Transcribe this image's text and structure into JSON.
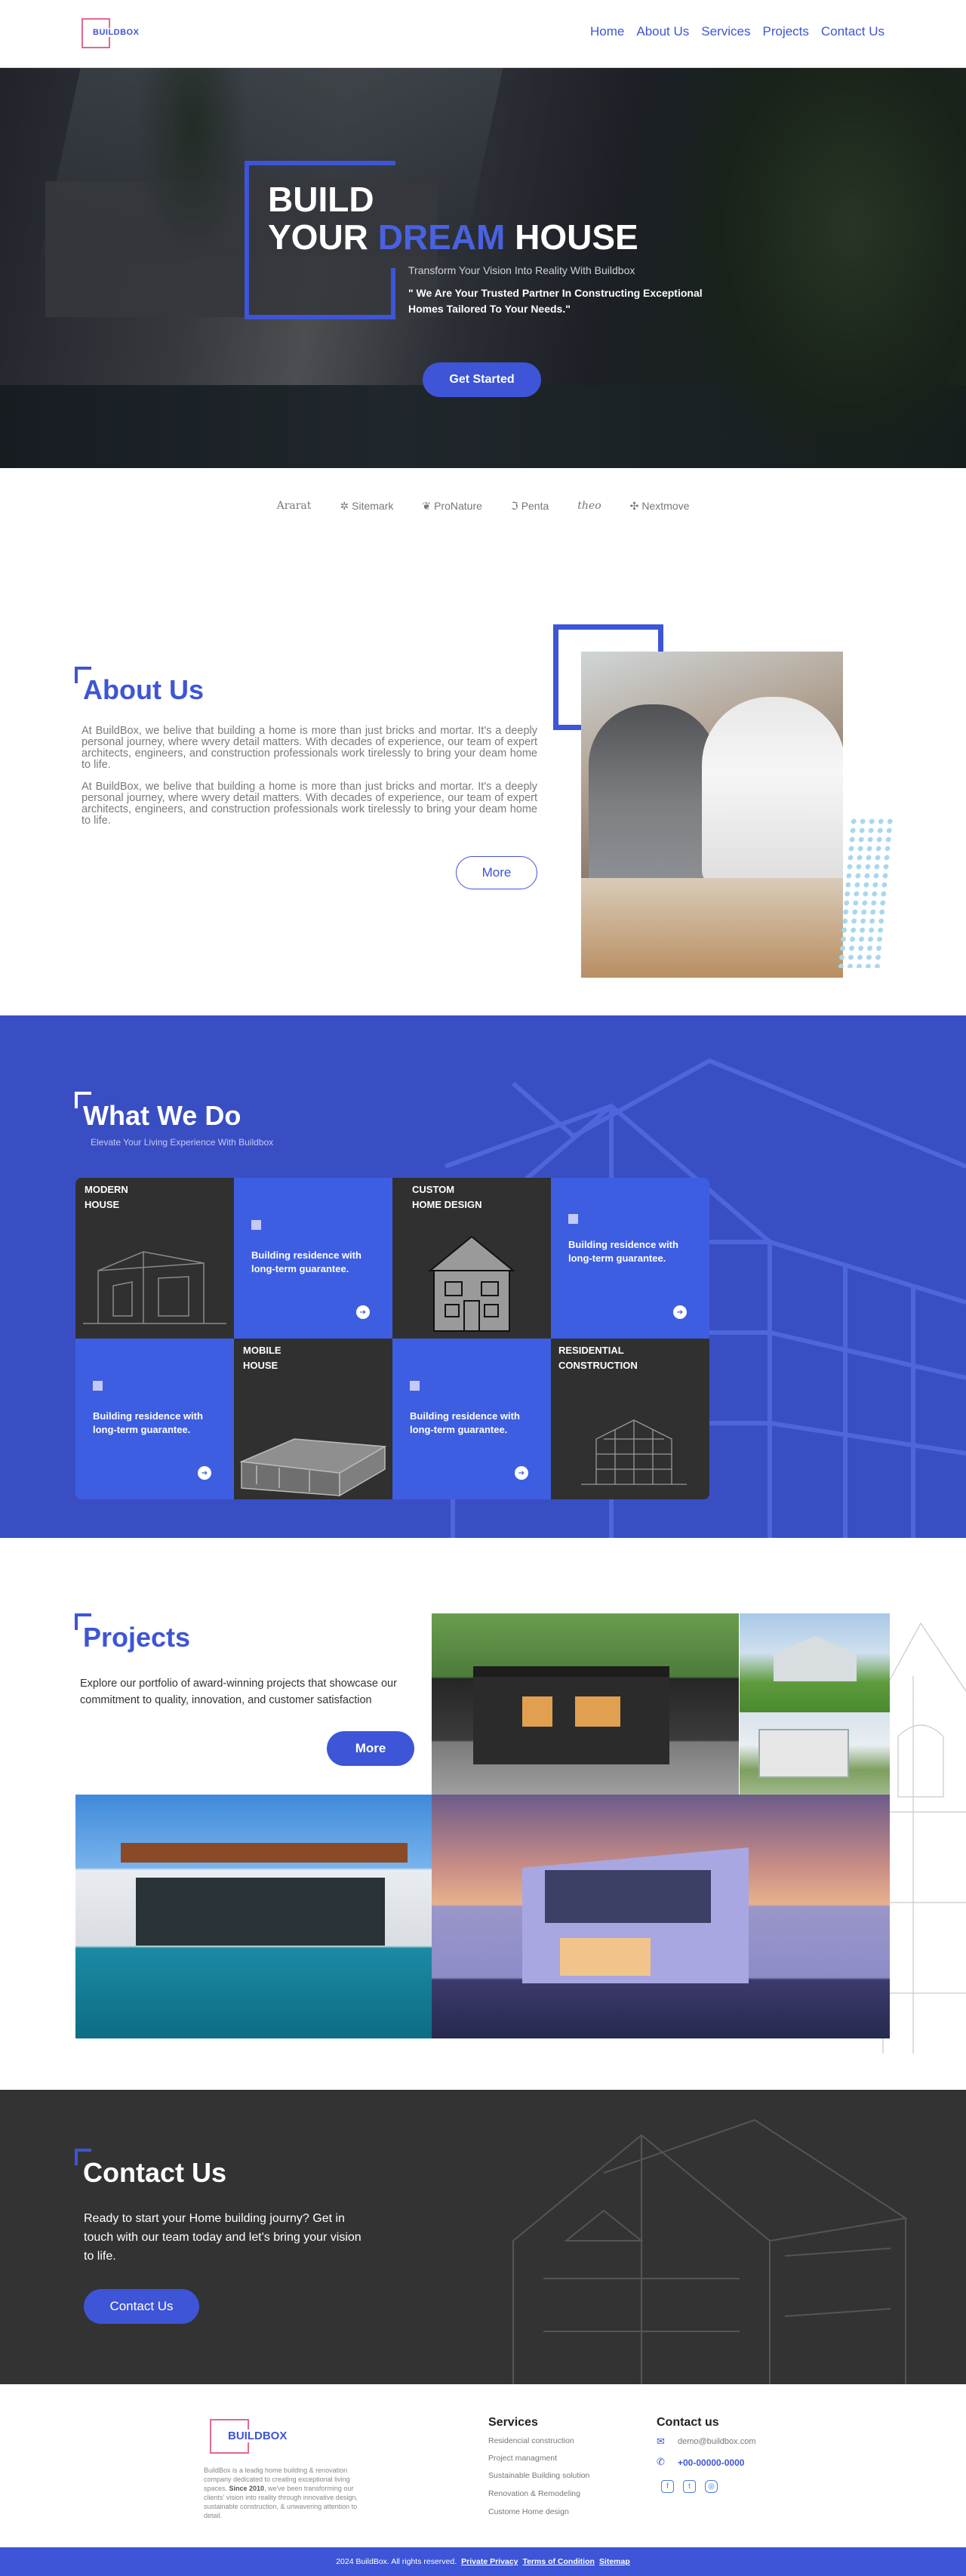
{
  "header": {
    "logo_text": "BUILDBOX",
    "nav": [
      {
        "label": "Home"
      },
      {
        "label": "About Us"
      },
      {
        "label": "Services"
      },
      {
        "label": "Projects"
      },
      {
        "label": "Contact Us"
      }
    ]
  },
  "hero": {
    "title_line1": "BUILD",
    "title_your": "YOUR ",
    "title_dream": "DREAM",
    "title_house": " HOUSE",
    "subtitle": "Transform Your Vision Into Reality With Buildbox",
    "quote": "\" We Are Your Trusted Partner In Constructing Exceptional Homes Tailored To Your Needs.\"",
    "cta_label": "Get Started"
  },
  "partners": [
    {
      "name": "Ararat",
      "icon": ""
    },
    {
      "name": "Sitemark",
      "icon": "asterisk-icon"
    },
    {
      "name": "ProNature",
      "icon": "leaf-icon"
    },
    {
      "name": "Penta",
      "icon": "penta-icon"
    },
    {
      "name": "theo",
      "icon": ""
    },
    {
      "name": "Nextmove",
      "icon": "arrows-icon"
    }
  ],
  "about": {
    "title": "About Us",
    "paragraph1": "At BuildBox, we belive that building a home is more than just bricks and mortar. It's a deeply personal journey, where wvery detail matters. With decades of experience, our team of expert architects, engineers, and construction professionals work tirelessly to bring your deam home to life.",
    "paragraph2": "At BuildBox, we belive that building a home is more than just bricks and mortar. It's a deeply personal journey, where wvery detail matters. With decades of experience, our team of expert architects, engineers, and construction professionals work tirelessly to bring your deam home to life.",
    "more_label": "More"
  },
  "services": {
    "title": "What We Do",
    "subtitle": "Elevate Your Living Experience With Buildbox",
    "cells": [
      {
        "kind": "image",
        "title": "MODERN\nHOUSE"
      },
      {
        "kind": "text",
        "text": "Building residence with long-term guarantee."
      },
      {
        "kind": "image",
        "title": "CUSTOM\nHOME DESIGN"
      },
      {
        "kind": "text",
        "text": "Building residence with long-term guarantee."
      },
      {
        "kind": "text",
        "text": "Building residence with long-term guarantee."
      },
      {
        "kind": "image",
        "title": "MOBILE\nHOUSE"
      },
      {
        "kind": "text",
        "text": "Building residence with long-term guarantee."
      },
      {
        "kind": "image",
        "title": "RESIDENTIAL\nCONSTRUCTION"
      }
    ]
  },
  "projects": {
    "title": "Projects",
    "text": "Explore our portfolio of award-winning projects that showcase our commitment to quality, innovation, and customer satisfaction",
    "more_label": "More"
  },
  "contact": {
    "title": "Contact Us",
    "text": "Ready to start your Home building journy? Get in touch with our team today and let's bring your vision to life.",
    "button_label": "Contact Us"
  },
  "footer": {
    "logo_text": "BUILDBOX",
    "description_a": "BuildBox is a leadig home building & renovation company dedicated to creating exceptional living spaces. ",
    "description_since": "Since 2010",
    "description_b": ", we've been transforming our clients' vision into reality through innovative design, sustainable construction, & unwavering attention to detail.",
    "services_title": "Services",
    "services": [
      "Residencial construction",
      "Project managment",
      "Sustainable Building solution",
      "Renovation & Remodeling",
      "Custome Home design"
    ],
    "contact_title": "Contact us",
    "email": "demo@buildbox.com",
    "phone": "+00-00000-0000",
    "socials": [
      "facebook-icon",
      "twitter-icon",
      "instagram-icon"
    ],
    "copyright": "2024 BuildBox. All rights reserved.",
    "links": [
      "Private Privacy",
      "Terms of Condition",
      "Sitemap"
    ]
  },
  "colors": {
    "primary": "#3d55d6",
    "services_bg": "#3a4ec4",
    "dark_bg": "#333333",
    "logo_accent": "#e06a8c"
  }
}
